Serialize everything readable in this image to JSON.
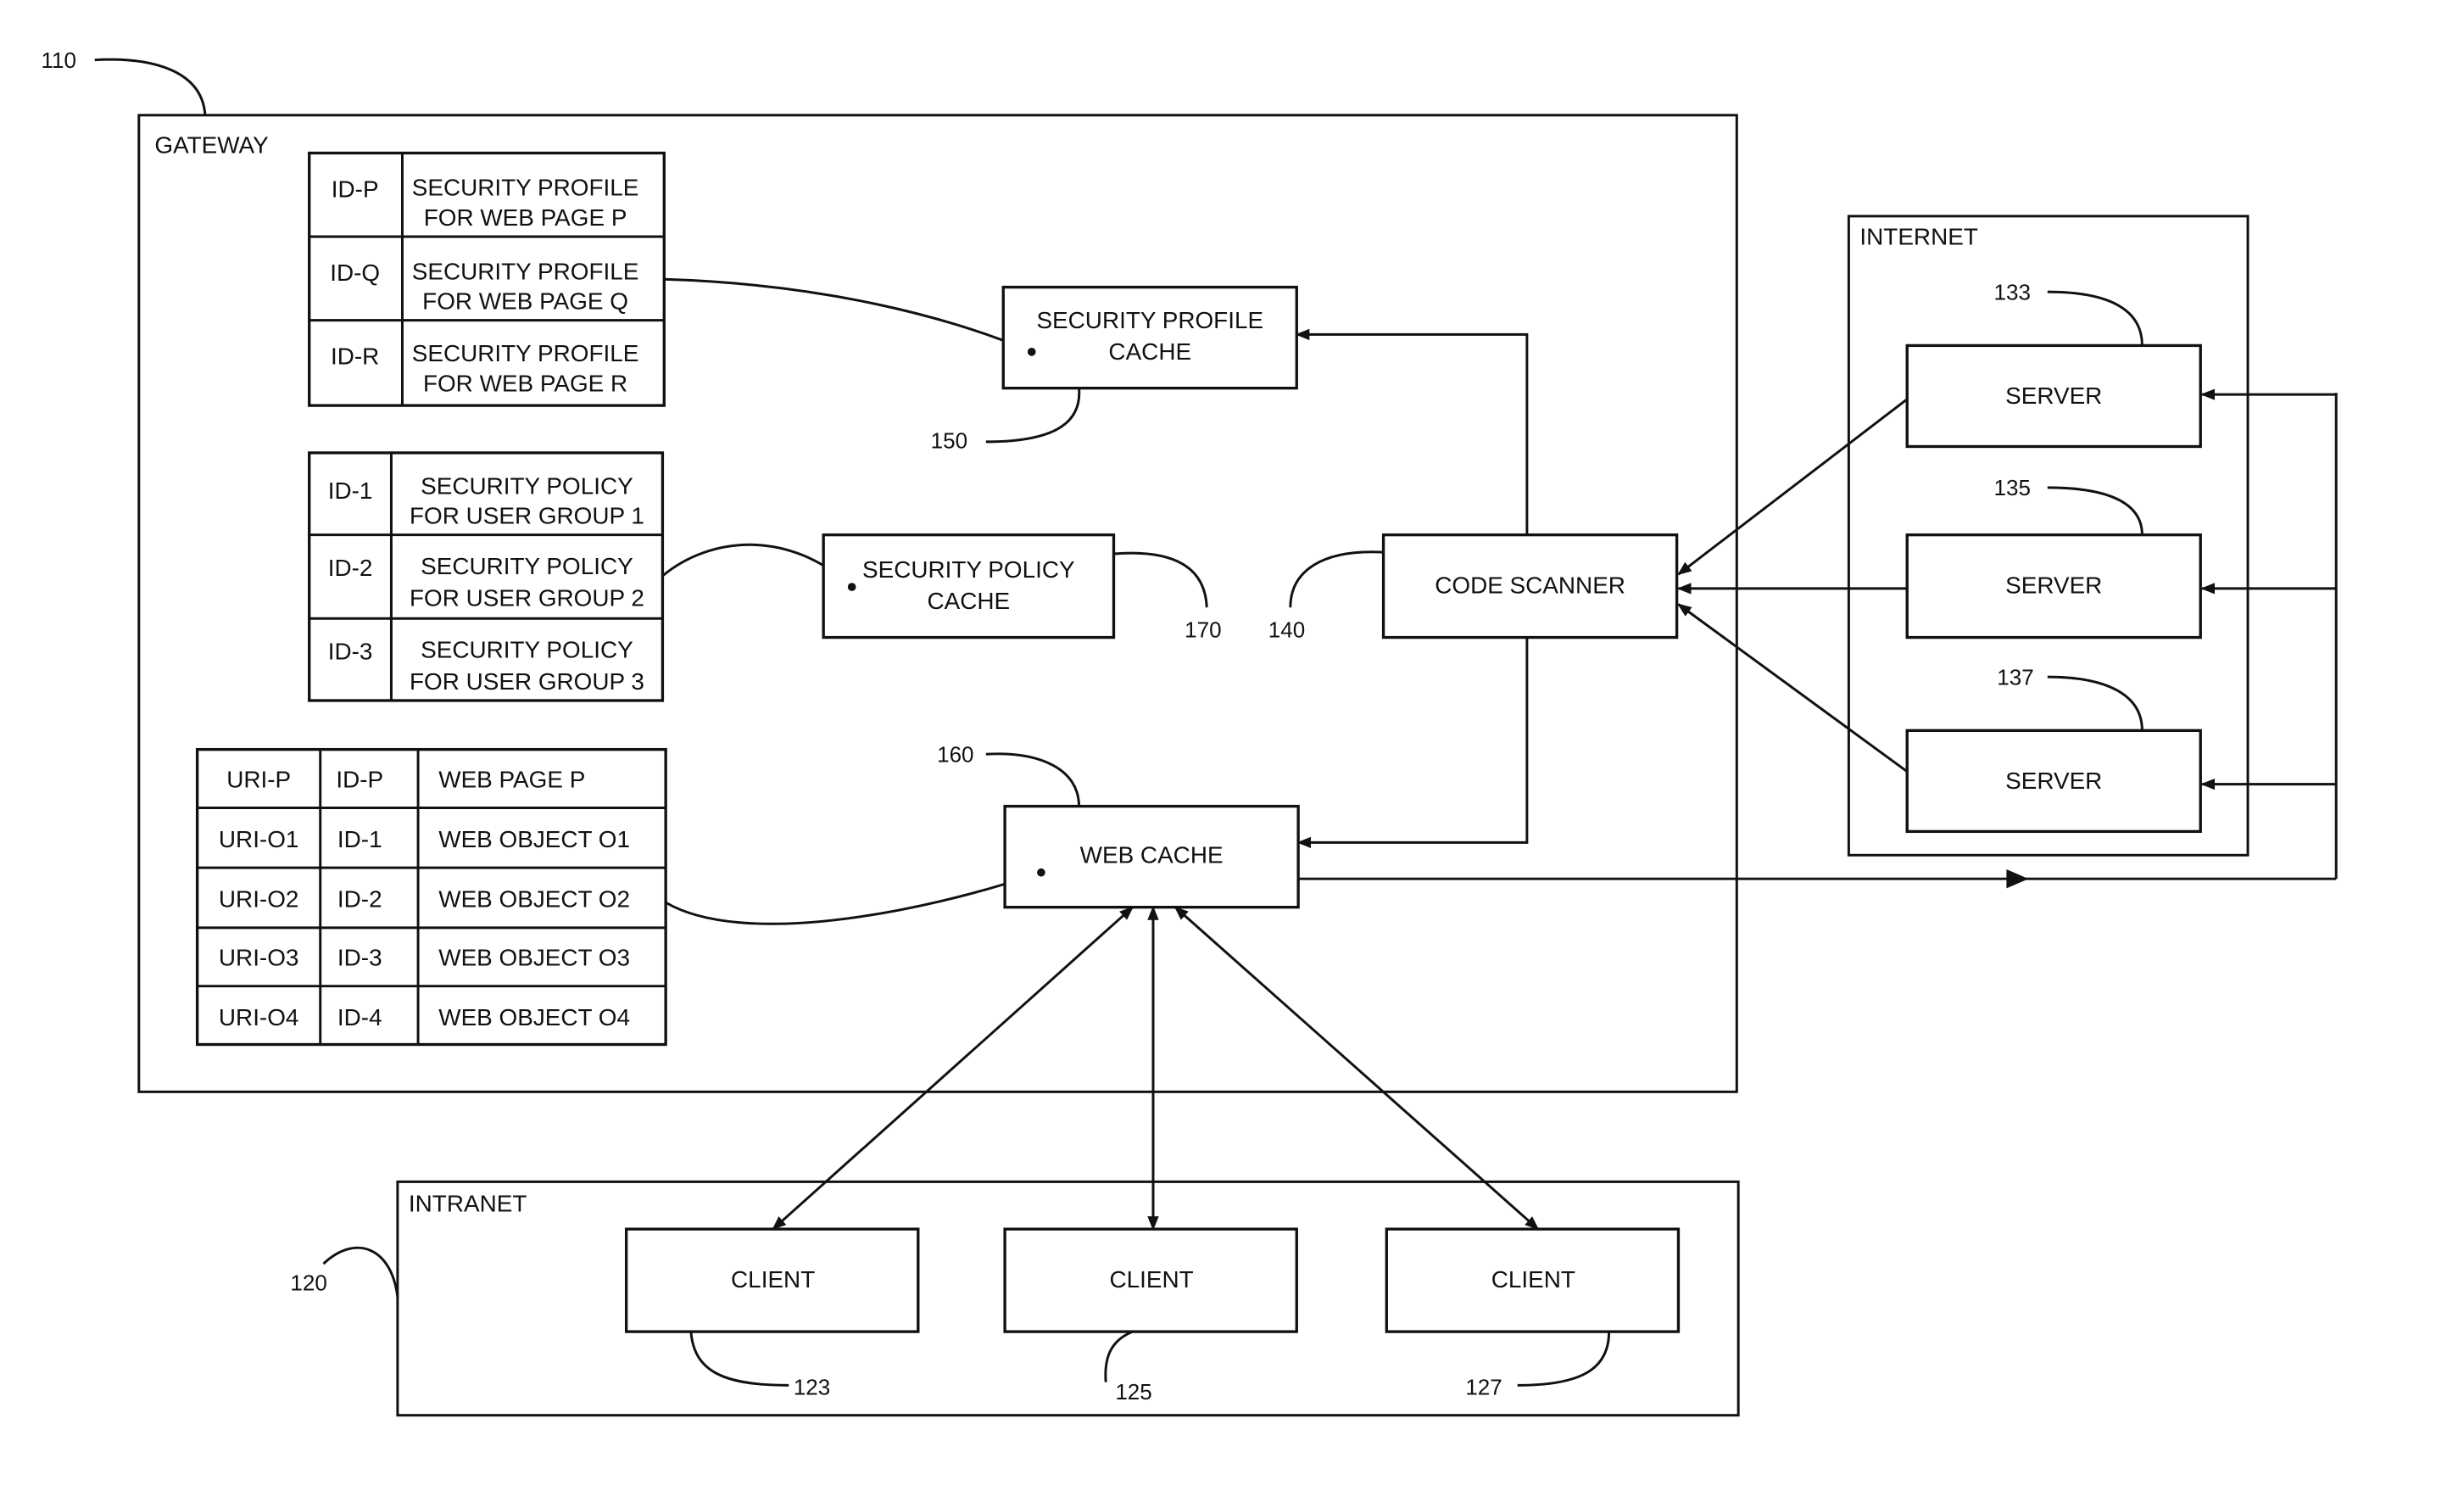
{
  "figure": {
    "gateway": {
      "ref": "110",
      "label": "GATEWAY",
      "profile_table": [
        {
          "id": "ID-P",
          "line1": "SECURITY PROFILE",
          "line2": "FOR WEB PAGE P"
        },
        {
          "id": "ID-Q",
          "line1": "SECURITY PROFILE",
          "line2": "FOR WEB PAGE Q"
        },
        {
          "id": "ID-R",
          "line1": "SECURITY PROFILE",
          "line2": "FOR WEB PAGE R"
        }
      ],
      "policy_table": [
        {
          "id": "ID-1",
          "line1": "SECURITY POLICY",
          "line2": "FOR USER GROUP 1"
        },
        {
          "id": "ID-2",
          "line1": "SECURITY POLICY",
          "line2": "FOR USER GROUP 2"
        },
        {
          "id": "ID-3",
          "line1": "SECURITY POLICY",
          "line2": "FOR USER GROUP 3"
        }
      ],
      "web_table": [
        {
          "uri": "URI-P",
          "id": "ID-P",
          "object": "WEB PAGE P"
        },
        {
          "uri": "URI-O1",
          "id": "ID-1",
          "object": "WEB OBJECT O1"
        },
        {
          "uri": "URI-O2",
          "id": "ID-2",
          "object": "WEB OBJECT O2"
        },
        {
          "uri": "URI-O3",
          "id": "ID-3",
          "object": "WEB OBJECT O3"
        },
        {
          "uri": "URI-O4",
          "id": "ID-4",
          "object": "WEB OBJECT O4"
        }
      ],
      "security_profile_cache": {
        "line1": "SECURITY PROFILE",
        "line2": "CACHE",
        "ref": "150"
      },
      "security_policy_cache": {
        "line1": "SECURITY POLICY",
        "line2": "CACHE",
        "ref": "170"
      },
      "code_scanner": {
        "label": "CODE SCANNER",
        "ref": "140"
      },
      "web_cache": {
        "label": "WEB CACHE",
        "ref": "160"
      }
    },
    "internet": {
      "label": "INTERNET",
      "servers": [
        {
          "label": "SERVER",
          "ref": "133"
        },
        {
          "label": "SERVER",
          "ref": "135"
        },
        {
          "label": "SERVER",
          "ref": "137"
        }
      ]
    },
    "intranet": {
      "label": "INTRANET",
      "ref": "120",
      "clients": [
        {
          "label": "CLIENT",
          "ref": "123"
        },
        {
          "label": "CLIENT",
          "ref": "125"
        },
        {
          "label": "CLIENT",
          "ref": "127"
        }
      ]
    }
  }
}
